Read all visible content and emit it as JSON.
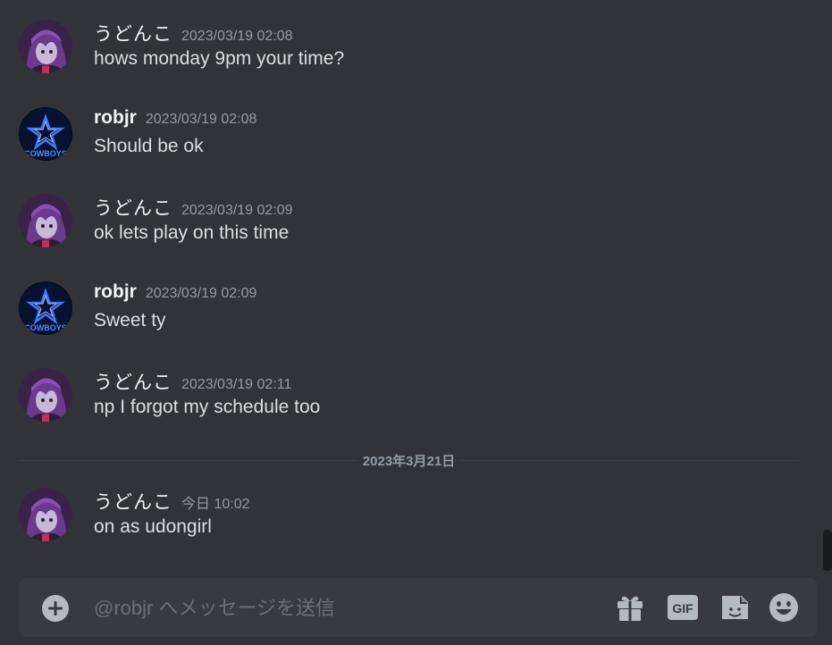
{
  "messages": [
    {
      "author": "うどんこ",
      "timestamp": "2023/03/19 02:08",
      "text": "hows monday 9pm your time?"
    },
    {
      "author": "robjr",
      "timestamp": "2023/03/19 02:08",
      "text": "Should be ok"
    },
    {
      "author": "うどんこ",
      "timestamp": "2023/03/19 02:09",
      "text": "ok lets play on this time"
    },
    {
      "author": "robjr",
      "timestamp": "2023/03/19 02:09",
      "text": "Sweet ty"
    },
    {
      "author": "うどんこ",
      "timestamp": "2023/03/19 02:11",
      "text": "np I forgot my schedule too"
    },
    {
      "author": "うどんこ",
      "timestamp": "今日 10:02",
      "text": "on as udongirl"
    }
  ],
  "divider": {
    "date": "2023年3月21日"
  },
  "avatars": {
    "robjr_text": "COWBOYS"
  },
  "composer": {
    "placeholder": "@robjr へメッセージを送信",
    "gif_label": "GIF"
  },
  "colors": {
    "background": "#313338",
    "composer": "#383a40",
    "text": "#dbdee1",
    "muted": "#949ba4",
    "author": "#f2f3f5",
    "icon": "#b5bac1"
  },
  "icons": {
    "add": "plus-circle-icon",
    "gift": "gift-icon",
    "gif": "gif-icon",
    "sticker": "sticker-icon",
    "emoji": "emoji-icon"
  }
}
